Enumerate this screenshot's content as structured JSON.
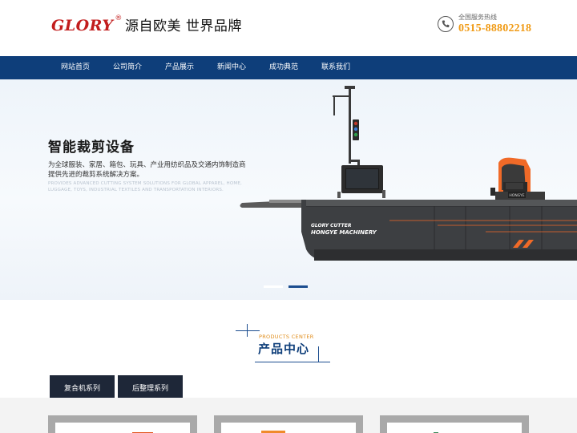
{
  "header": {
    "brand": "GLORY",
    "registered_mark": "®",
    "slogan": "源自欧美 世界品牌",
    "hotline_label": "全国服务热线",
    "hotline_number": "0515-88802218",
    "phone_icon": "phone-icon"
  },
  "nav": {
    "items": [
      {
        "label": "网站首页"
      },
      {
        "label": "公司简介"
      },
      {
        "label": "产品展示"
      },
      {
        "label": "新闻中心"
      },
      {
        "label": "成功典范"
      },
      {
        "label": "联系我们"
      }
    ]
  },
  "banner": {
    "title": "智能裁剪设备",
    "description": "为全球服装、家居、箱包、玩具、产业用纺织品及交通内饰制造商提供先进的裁剪系统解决方案。",
    "description_en": "PROVIDES ADVANCED CUTTING SYSTEM SOLUTIONS FOR GLOBAL APPAREL, HOME, LUGGAGE, TOYS, INDUSTRIAL TEXTILES AND TRANSPORTATION INTERIORS.",
    "machine_text_1": "GLORY CUTTER",
    "machine_text_2": "HONGYE MACHINERY",
    "machine_badge": "HONGYE",
    "active_slide": 2,
    "slide_count": 2
  },
  "products_section": {
    "title_en": "PRODUCTS CENTER",
    "title_cn": "产品中心",
    "tabs": [
      {
        "label": "复合机系列"
      },
      {
        "label": "后整理系列"
      }
    ]
  },
  "colors": {
    "brand_red": "#c21d1d",
    "nav_blue": "#0e3e7a",
    "hotline_orange": "#f09a14",
    "tab_dark": "#1e2738",
    "accent_orange": "#e08d1b"
  }
}
